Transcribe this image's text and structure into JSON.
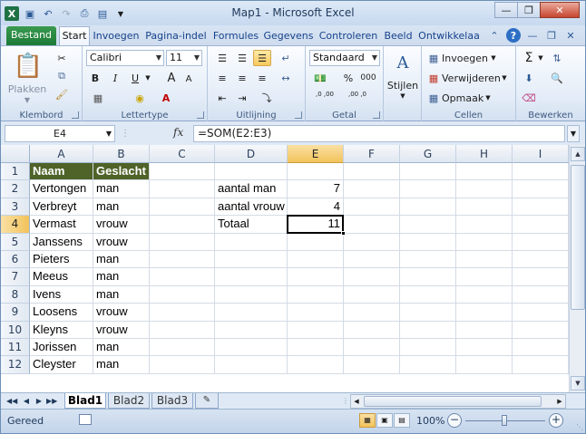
{
  "window": {
    "title": "Map1 - Microsoft Excel"
  },
  "qat": {
    "undo_icon": "undo-icon",
    "redo_icon": "redo-icon"
  },
  "tabs": [
    {
      "label": "Bestand"
    },
    {
      "label": "Start"
    },
    {
      "label": "Invoegen"
    },
    {
      "label": "Pagina-indel"
    },
    {
      "label": "Formules"
    },
    {
      "label": "Gegevens"
    },
    {
      "label": "Controleren"
    },
    {
      "label": "Beeld"
    },
    {
      "label": "Ontwikkelaa"
    }
  ],
  "ribbon": {
    "clipboard": {
      "paste_label": "Plakken",
      "group_label": "Klembord"
    },
    "font": {
      "family": "Calibri",
      "size": "11",
      "group_label": "Lettertype",
      "bold": "B",
      "italic": "I",
      "underline": "U",
      "grow": "A",
      "shrink": "A",
      "color": "A"
    },
    "alignment": {
      "group_label": "Uitlijning"
    },
    "number": {
      "format": "Standaard",
      "percent": "%",
      "thousands": "000",
      "inc_dec": ",0 ,00",
      "dec_dec": ",00 ,0",
      "group_label": "Getal"
    },
    "styles": {
      "label": "Stijlen"
    },
    "cells": {
      "insert": "Invoegen",
      "delete": "Verwijderen",
      "format": "Opmaak",
      "group_label": "Cellen"
    },
    "editing": {
      "group_label": "Bewerken"
    }
  },
  "formula_bar": {
    "name_box": "E4",
    "fx": "fx",
    "formula": "=SOM(E2:E3)"
  },
  "columns": [
    "A",
    "B",
    "C",
    "D",
    "E",
    "F",
    "G",
    "H",
    "I"
  ],
  "rows": [
    "1",
    "2",
    "3",
    "4",
    "5",
    "6",
    "7",
    "8",
    "9",
    "10",
    "11",
    "12"
  ],
  "cells": {
    "A1": "Naam",
    "B1": "Geslacht",
    "A2": "Vertongen",
    "B2": "man",
    "D2": "aantal man",
    "E2": "7",
    "A3": "Verbreyt",
    "B3": "man",
    "D3": "aantal vrouw",
    "E3": "4",
    "A4": "Vermast",
    "B4": "vrouw",
    "D4": "Totaal",
    "E4": "11",
    "A5": "Janssens",
    "B5": "vrouw",
    "A6": "Pieters",
    "B6": "man",
    "A7": "Meeus",
    "B7": "man",
    "A8": "Ivens",
    "B8": "man",
    "A9": "Loosens",
    "B9": "vrouw",
    "A10": "Kleyns",
    "B10": "vrouw",
    "A11": "Jorissen",
    "B11": "man",
    "A12": "Cleyster",
    "B12": "man"
  },
  "sheets": [
    {
      "label": "Blad1"
    },
    {
      "label": "Blad2"
    },
    {
      "label": "Blad3"
    }
  ],
  "status": {
    "ready": "Gereed",
    "zoom": "100%",
    "minus": "−",
    "plus": "+"
  },
  "colors": {
    "header_fill": "#4f6228",
    "accent": "#1f7244"
  }
}
